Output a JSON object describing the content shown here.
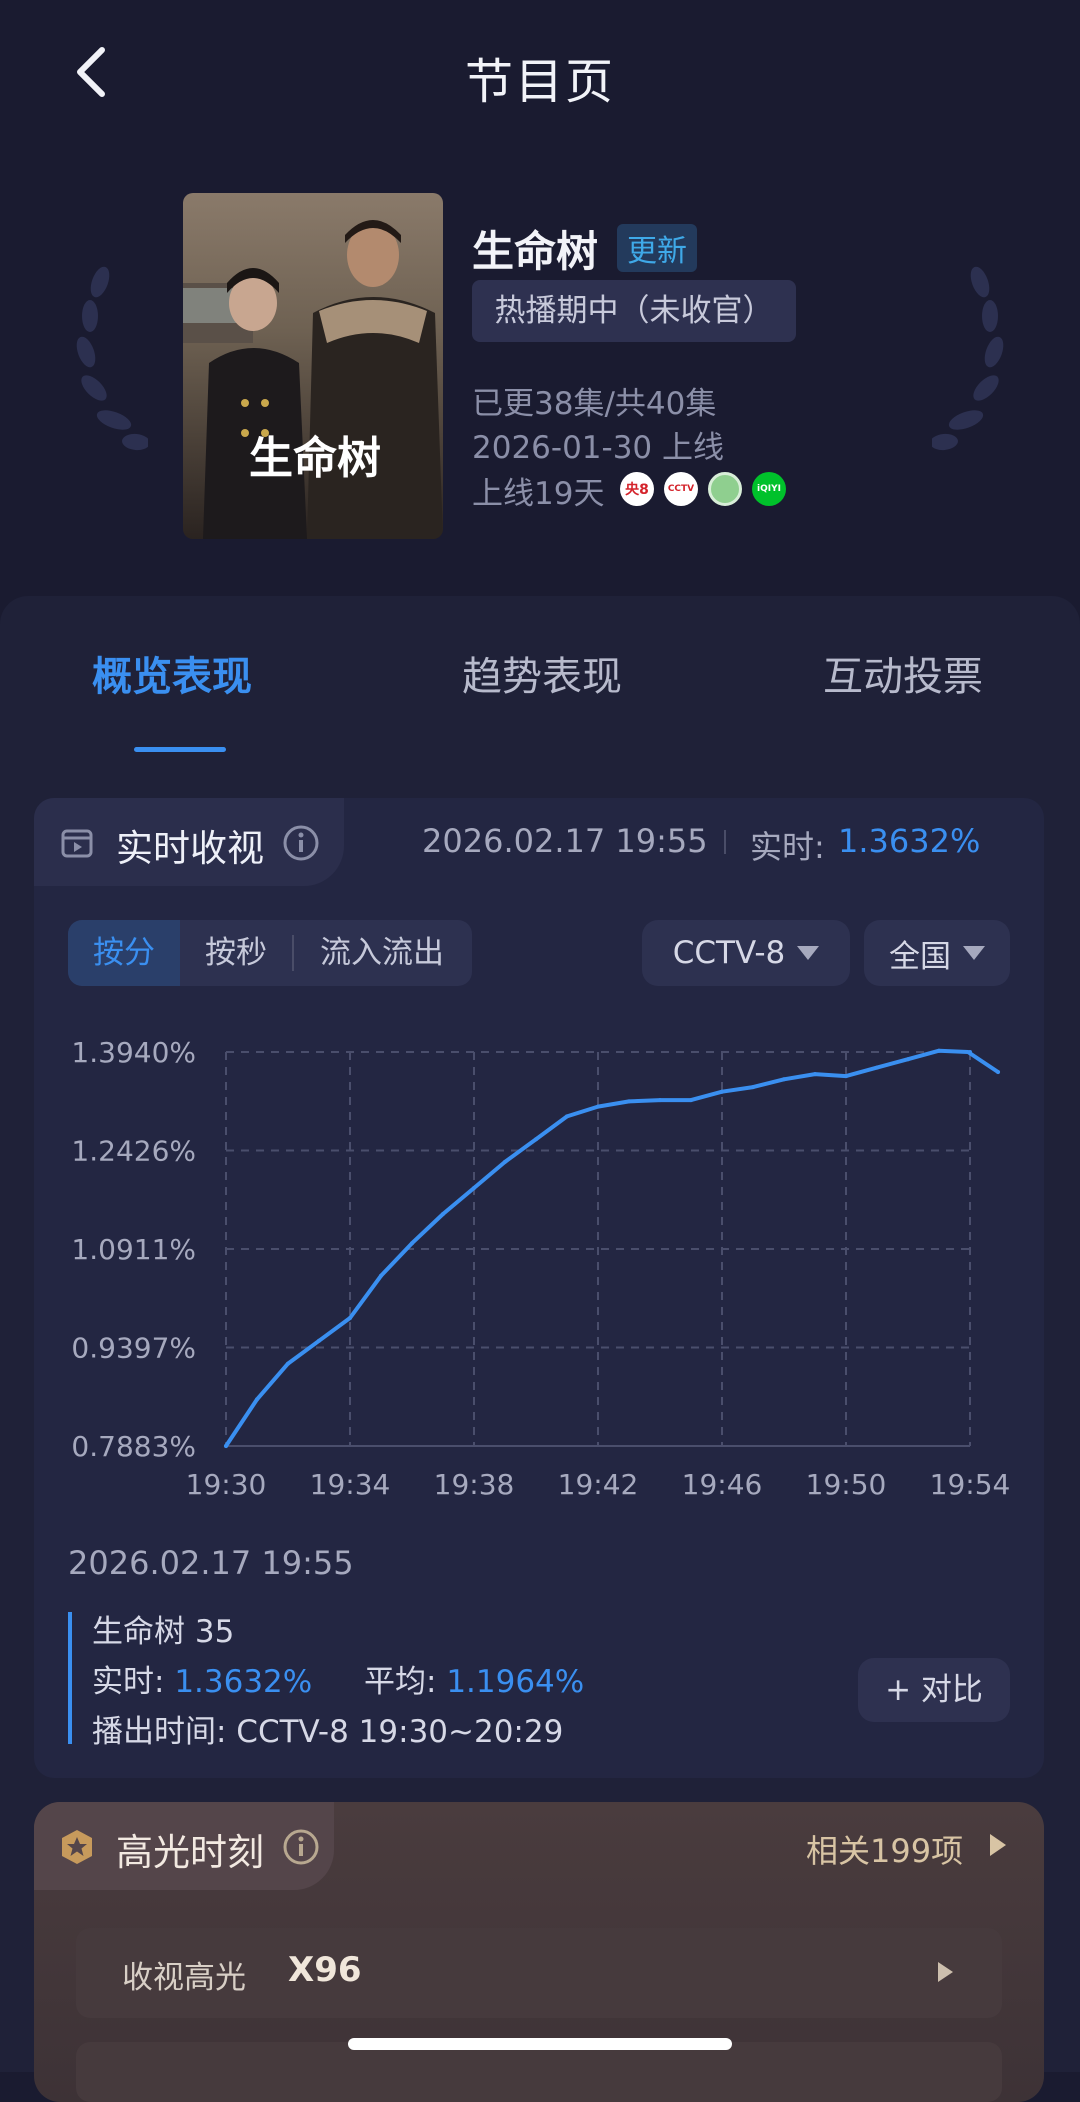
{
  "header": {
    "title": "节目页",
    "back_icon": "chevron-left-icon"
  },
  "program": {
    "title": "生命树",
    "badge": "更新",
    "status": "热播期中（未收官）",
    "episodes": "已更38集/共40集",
    "premiere": "2026-01-30 上线",
    "days_online": "上线19天",
    "poster_caption": "生命树",
    "platforms": [
      {
        "name": "cctv8-icon",
        "label": "央8",
        "color": "#ffffff"
      },
      {
        "name": "cctv-app-icon",
        "label": "CCTV",
        "color": "#ffffff"
      },
      {
        "name": "green-platform-icon",
        "label": "",
        "color": "#8fcf8f"
      },
      {
        "name": "iqiyi-icon",
        "label": "iQIYI",
        "color": "#00c12b"
      }
    ]
  },
  "tabs": [
    {
      "label": "概览表现",
      "active": true
    },
    {
      "label": "趋势表现",
      "active": false
    },
    {
      "label": "互动投票",
      "active": false
    }
  ],
  "realtime": {
    "title": "实时收视",
    "timestamp": "2026.02.17 19:55",
    "realtime_label": "实时: ",
    "realtime_value": "1.3632%",
    "segments": [
      "按分",
      "按秒",
      "流入流出"
    ],
    "active_segment": "按分",
    "channel": "CCTV-8",
    "region": "全国"
  },
  "chart_data": {
    "type": "line",
    "x": [
      "19:30",
      "19:31",
      "19:32",
      "19:33",
      "19:34",
      "19:35",
      "19:36",
      "19:37",
      "19:38",
      "19:39",
      "19:40",
      "19:41",
      "19:42",
      "19:43",
      "19:44",
      "19:45",
      "19:46",
      "19:47",
      "19:48",
      "19:49",
      "19:50",
      "19:51",
      "19:52",
      "19:53",
      "19:54",
      "19:55"
    ],
    "series": [
      {
        "values": [
          0.7883,
          0.86,
          0.915,
          0.95,
          0.985,
          1.05,
          1.1,
          1.145,
          1.185,
          1.225,
          1.26,
          1.295,
          1.31,
          1.318,
          1.32,
          1.32,
          1.333,
          1.34,
          1.352,
          1.36,
          1.357,
          1.37,
          1.383,
          1.396,
          1.394,
          1.3632
        ]
      }
    ],
    "xticks": [
      "19:30",
      "19:34",
      "19:38",
      "19:42",
      "19:46",
      "19:50",
      "19:54"
    ],
    "yticks": [
      "1.3940%",
      "1.2426%",
      "1.0911%",
      "0.9397%",
      "0.7883%"
    ],
    "ylim": [
      0.7883,
      1.394
    ],
    "grid": true,
    "color": "#3a8ff0"
  },
  "summary": {
    "date": "2026.02.17 19:55",
    "program_line": "生命树 35",
    "realtime_label": "实时: ",
    "realtime_value": "1.3632%",
    "average_label": "平均: ",
    "average_value": "1.1964%",
    "airtime": "播出时间: CCTV-8 19:30~20:29",
    "compare_button": "+ 对比"
  },
  "highlights": {
    "title": "高光时刻",
    "more": "相关199项",
    "row_label": "收视高光",
    "row_value": "X96"
  },
  "colors": {
    "accent": "#3a8ff0",
    "background": "#1a1b30",
    "highlight_gold": "#d8c4a4"
  }
}
